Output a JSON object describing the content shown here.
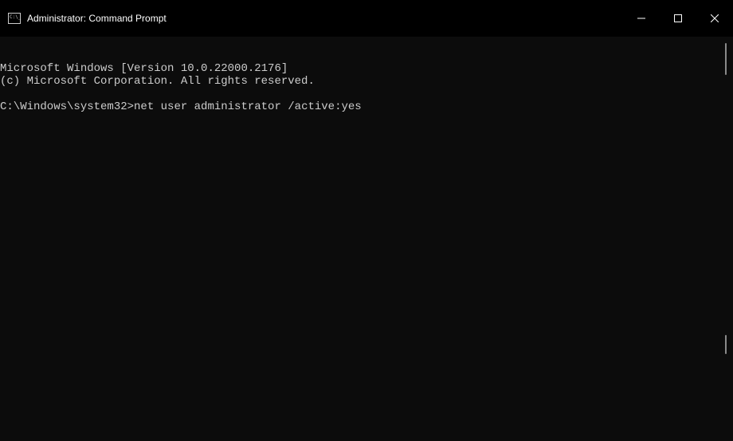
{
  "window": {
    "title": "Administrator: Command Prompt"
  },
  "terminal": {
    "line1": "Microsoft Windows [Version 10.0.22000.2176]",
    "line2": "(c) Microsoft Corporation. All rights reserved.",
    "blank": "",
    "prompt": "C:\\Windows\\system32>",
    "command": "net user administrator /active:yes"
  }
}
